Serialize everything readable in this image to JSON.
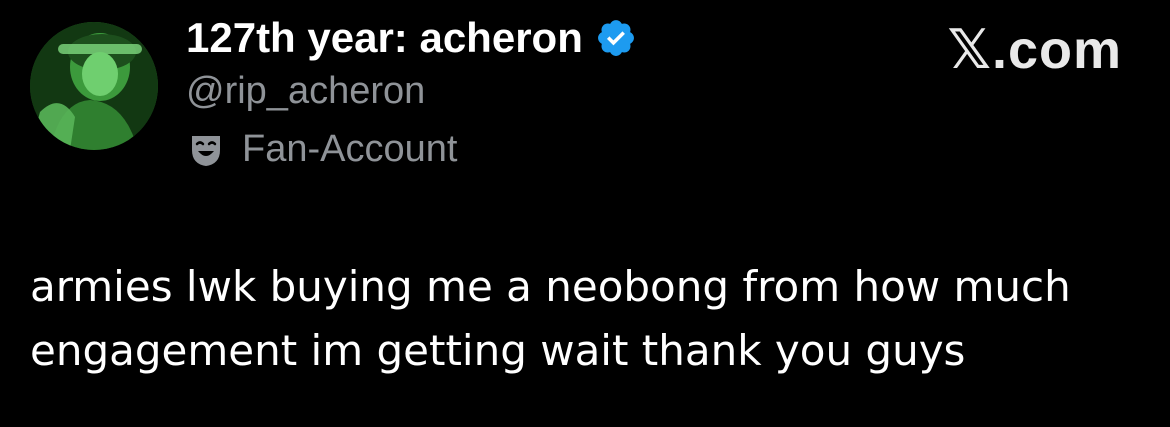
{
  "author": {
    "display_name": "127th year: acheron",
    "handle": "@rip_acheron",
    "label": "Fan-Account",
    "label_icon": "theater-mask-icon",
    "verified": true,
    "verified_color": "#1d9bf0"
  },
  "brand": {
    "text": "𝕏.com"
  },
  "tweet": {
    "lines": [
      "armies lwk buying me a neobong from how much",
      "engagement im getting wait thank you guys"
    ]
  },
  "colors": {
    "background": "#000000",
    "text_primary": "#ffffff",
    "text_secondary": "#8f9398"
  }
}
